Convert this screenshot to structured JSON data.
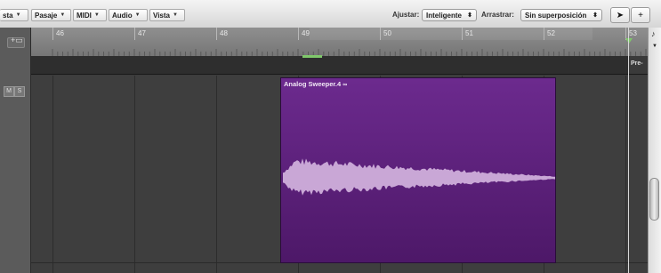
{
  "toolbar": {
    "menus": [
      {
        "label": "sta"
      },
      {
        "label": "Pasaje"
      },
      {
        "label": "MIDI"
      },
      {
        "label": "Audio"
      },
      {
        "label": "Vista"
      }
    ],
    "snap_label": "Ajustar:",
    "snap_value": "Inteligente",
    "drag_label": "Arrastrar:",
    "drag_value": "Sin superposición"
  },
  "ruler": {
    "bars": [
      "46",
      "47",
      "48",
      "49",
      "50",
      "51",
      "52",
      "53"
    ]
  },
  "marker": {
    "pre_label": "Pre-"
  },
  "track": {
    "mute": "M",
    "solo": "S"
  },
  "region": {
    "name": "Analog Sweeper.4",
    "color": "#5e2180",
    "waveform_color": "#c9a7d6"
  },
  "colors": {
    "playhead": "#d8d8d8",
    "cycle_marker": "#7fc86b"
  }
}
